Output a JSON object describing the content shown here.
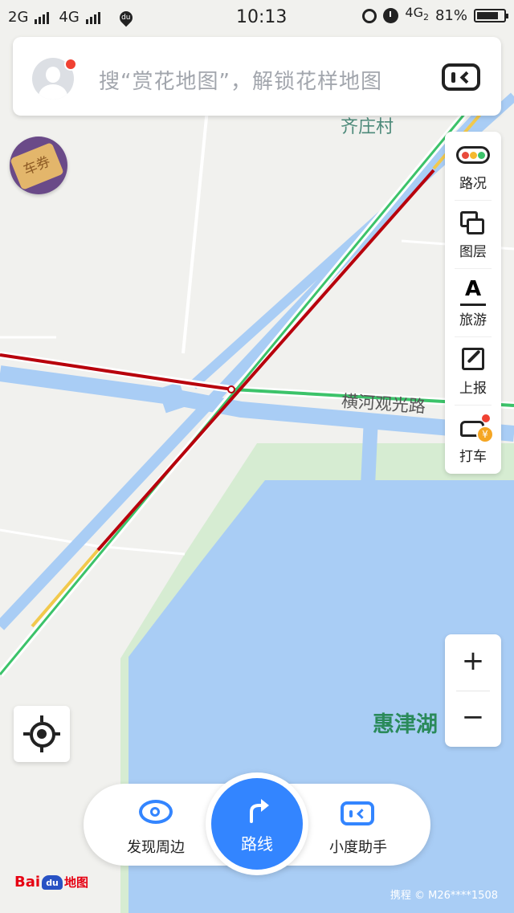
{
  "status_bar": {
    "sim1": "2G",
    "sim2": "4G",
    "du": "du",
    "time": "10:13",
    "network": "4G",
    "network_sub": "2",
    "battery": "81%",
    "battery_level": 0.81
  },
  "search": {
    "placeholder": "搜“赏花地图”，解锁花样地图"
  },
  "coupon": {
    "label": "车券"
  },
  "tools": [
    {
      "label": "路况"
    },
    {
      "label": "图层"
    },
    {
      "label": "旅游"
    },
    {
      "label": "上报"
    },
    {
      "label": "打车"
    }
  ],
  "map_labels": {
    "village": "齐庄村",
    "road": "横河观光路",
    "lake": "惠津湖"
  },
  "zoom": {
    "in": "+",
    "out": "−"
  },
  "bottom_bar": {
    "discover": "发现周边",
    "route": "路线",
    "assistant": "小度助手"
  },
  "logo": {
    "bai": "Bai",
    "du": "du",
    "map": "地图"
  },
  "copyright": "携程 © M26****1508",
  "colors": {
    "accent": "#3385ff",
    "water": "#a9cdf5",
    "green": "#d6ecd2",
    "traffic_red": "#b8000c",
    "traffic_green": "#3cc36a",
    "traffic_yellow": "#f2c94c"
  }
}
